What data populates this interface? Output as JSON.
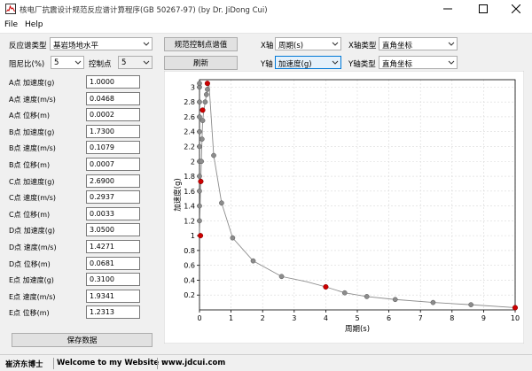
{
  "window": {
    "title": "核电厂抗震设计规范反应谱计算程序(GB 50267-97) (by Dr. JiDong Cui)"
  },
  "menu": [
    "File",
    "Help"
  ],
  "controls": {
    "spectrum_type_label": "反应谱类型",
    "spectrum_type_value": "基岩场地水平",
    "damping_label": "阻尼比(%)",
    "damping_value": "5",
    "control_points_label": "控制点",
    "control_points_value": "5",
    "calc_button": "规范控制点谱值",
    "refresh_button": "刷新",
    "x_axis_label": "X轴",
    "x_axis_value": "周期(s)",
    "y_axis_label": "Y轴",
    "y_axis_value": "加速度(g)",
    "x_axis_type_label": "X轴类型",
    "x_axis_type_value": "直角坐标",
    "y_axis_type_label": "Y轴类型",
    "y_axis_type_value": "直角坐标"
  },
  "fields": [
    {
      "label": "A点 加速度(g)",
      "value": "1.0000"
    },
    {
      "label": "A点 速度(m/s)",
      "value": "0.0468"
    },
    {
      "label": "A点 位移(m)",
      "value": "0.0002"
    },
    {
      "label": "B点 加速度(g)",
      "value": "1.7300"
    },
    {
      "label": "B点 速度(m/s)",
      "value": "0.1079"
    },
    {
      "label": "B点 位移(m)",
      "value": "0.0007"
    },
    {
      "label": "C点 加速度(g)",
      "value": "2.6900"
    },
    {
      "label": "C点 速度(m/s)",
      "value": "0.2937"
    },
    {
      "label": "C点 位移(m)",
      "value": "0.0033"
    },
    {
      "label": "D点 加速度(g)",
      "value": "3.0500"
    },
    {
      "label": "D点 速度(m/s)",
      "value": "1.4271"
    },
    {
      "label": "D点 位移(m)",
      "value": "0.0681"
    },
    {
      "label": "E点 加速度(g)",
      "value": "0.3100"
    },
    {
      "label": "E点 速度(m/s)",
      "value": "1.9341"
    },
    {
      "label": "E点 位移(m)",
      "value": "1.2313"
    }
  ],
  "save_button": "保存数据",
  "status": {
    "author": "崔济东博士",
    "welcome": "Welcome to my Website :",
    "website": "www.jdcui.com"
  },
  "chart_data": {
    "type": "line",
    "xlabel": "周期(s)",
    "ylabel": "加速度(g)",
    "xlim": [
      0,
      10
    ],
    "ylim": [
      0,
      3.1
    ],
    "xticks": [
      0,
      1,
      2,
      3,
      4,
      5,
      6,
      7,
      8,
      9,
      10
    ],
    "yticks": [
      0.2,
      0.4,
      0.6,
      0.8,
      1,
      1.2,
      1.4,
      1.6,
      1.8,
      2,
      2.2,
      2.4,
      2.6,
      2.8,
      3
    ],
    "grid": true,
    "colors": {
      "line": "#8c8c8c",
      "marker": "#8c8c8c",
      "control": "#cc0000"
    },
    "curve": {
      "x": [
        0,
        0.01,
        0.02,
        0.03,
        0.04,
        0.06,
        0.08,
        0.1,
        0.14,
        0.18,
        0.22,
        0.25,
        0.3,
        0.45,
        0.7,
        1.05,
        1.7,
        2.6,
        3.4,
        4.0,
        4.6,
        5.3,
        6.2,
        7.4,
        8.6,
        10
      ],
      "y": [
        1.0,
        1.2,
        1.4,
        1.6,
        1.73,
        2.0,
        2.3,
        2.55,
        2.69,
        2.8,
        2.9,
        2.97,
        3.05,
        2.08,
        1.44,
        0.97,
        0.66,
        0.45,
        0.38,
        0.31,
        0.23,
        0.18,
        0.14,
        0.1,
        0.07,
        0.03
      ]
    },
    "markers": {
      "x": [
        0,
        0,
        0,
        0,
        0,
        0,
        0,
        0,
        0,
        0,
        0,
        0.04,
        0.06,
        0.08,
        0.1,
        0.18,
        0.22,
        0.25,
        0.45,
        0.7,
        1.05,
        1.7,
        2.6,
        4.6,
        5.3,
        6.2,
        7.4,
        8.6
      ],
      "y": [
        1.2,
        1.4,
        1.6,
        1.8,
        2.0,
        2.2,
        2.4,
        2.6,
        2.8,
        3.0,
        3.05,
        1.73,
        2.0,
        2.3,
        2.55,
        2.8,
        2.9,
        2.97,
        2.08,
        1.44,
        0.97,
        0.66,
        0.45,
        0.23,
        0.18,
        0.14,
        0.1,
        0.07
      ]
    },
    "control_points": {
      "x": [
        0.03,
        0.04,
        0.1,
        0.25,
        4.0,
        10
      ],
      "y": [
        1.0,
        1.73,
        2.69,
        3.05,
        0.31,
        0.03
      ]
    }
  }
}
